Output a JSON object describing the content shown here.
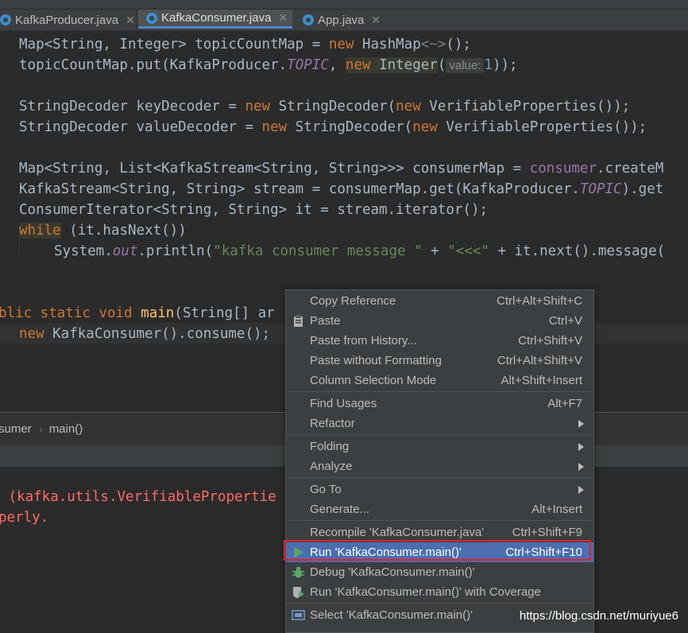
{
  "tabs": [
    {
      "label": "KafkaProducer.java"
    },
    {
      "label": "KafkaConsumer.java"
    },
    {
      "label": "App.java"
    }
  ],
  "code": {
    "l1": {
      "a": "Map<String, Integer> topicCountMap = ",
      "b": "new",
      "c": " HashMap",
      "d": "<~>",
      "e": "();"
    },
    "l2": {
      "a": "topicCountMap.put(KafkaProducer.",
      "b": "TOPIC",
      "c": ", ",
      "d": "new",
      "e": " Integer",
      "f": "(",
      "hint": "value:",
      "num": "1",
      "g": "));"
    },
    "l3": {
      "a": "StringDecoder keyDecoder = ",
      "b": "new",
      "c": " StringDecoder(",
      "d": "new",
      "e": " VerifiableProperties());"
    },
    "l4": {
      "a": "StringDecoder valueDecoder = ",
      "b": "new",
      "c": " StringDecoder(",
      "d": "new",
      "e": " VerifiableProperties());"
    },
    "l5": {
      "a": "Map<String, List<KafkaStream<String, String>>> consumerMap = ",
      "b": "consumer",
      "c": ".createM"
    },
    "l6": {
      "a": "KafkaStream<String, String> stream = consumerMap.get(KafkaProducer.",
      "b": "TOPIC",
      "c": ").get"
    },
    "l7": {
      "a": "ConsumerIterator<String, String> it = stream.iterator();"
    },
    "l8": {
      "a": "while",
      "b": " (it.hasNext())"
    },
    "l9": {
      "a": "System.",
      "b": "out",
      "c": ".println(",
      "d": "\"kafka consumer message \"",
      "e": " + ",
      "f": "\"<<<\"",
      "g": " + it.next().message("
    },
    "l10": {
      "a": "blic static void ",
      "b": "main",
      "c": "(String[] ar"
    },
    "l11": {
      "a": "new",
      "b": " KafkaConsumer().consume();"
    }
  },
  "breadcrumb": {
    "class": "sumer",
    "method": "main()"
  },
  "console": {
    "line1": " (kafka.utils.VerifiablePropertie",
    "line2": "perly."
  },
  "menu": {
    "items": [
      {
        "label": "Copy Reference",
        "shortcut": "Ctrl+Alt+Shift+C"
      },
      {
        "label": "Paste",
        "shortcut": "Ctrl+V"
      },
      {
        "label": "Paste from History...",
        "shortcut": "Ctrl+Shift+V"
      },
      {
        "label": "Paste without Formatting",
        "shortcut": "Ctrl+Alt+Shift+V"
      },
      {
        "label": "Column Selection Mode",
        "shortcut": "Alt+Shift+Insert"
      },
      {
        "label": "Find Usages",
        "shortcut": "Alt+F7"
      },
      {
        "label": "Refactor",
        "shortcut": ""
      },
      {
        "label": "Folding",
        "shortcut": ""
      },
      {
        "label": "Analyze",
        "shortcut": ""
      },
      {
        "label": "Go To",
        "shortcut": ""
      },
      {
        "label": "Generate...",
        "shortcut": "Alt+Insert"
      },
      {
        "label": "Recompile 'KafkaConsumer.java'",
        "shortcut": "Ctrl+Shift+F9"
      },
      {
        "label": "Run 'KafkaConsumer.main()'",
        "shortcut": "Ctrl+Shift+F10"
      },
      {
        "label": "Debug 'KafkaConsumer.main()'",
        "shortcut": ""
      },
      {
        "label": "Run 'KafkaConsumer.main()' with Coverage",
        "shortcut": ""
      },
      {
        "label": "Select 'KafkaConsumer.main()'",
        "shortcut": ""
      }
    ]
  },
  "icons": {
    "paste": "clipboard-icon",
    "run": "run-triangle-icon",
    "debug": "bug-icon",
    "coverage": "coverage-shield-icon",
    "select": "select-target-icon"
  },
  "colors": {
    "menu_selected": "#4b6eaf",
    "highlight_box": "#e2202c",
    "keyword": "#cc7832"
  },
  "watermark": "https://blog.csdn.net/muriyue6"
}
